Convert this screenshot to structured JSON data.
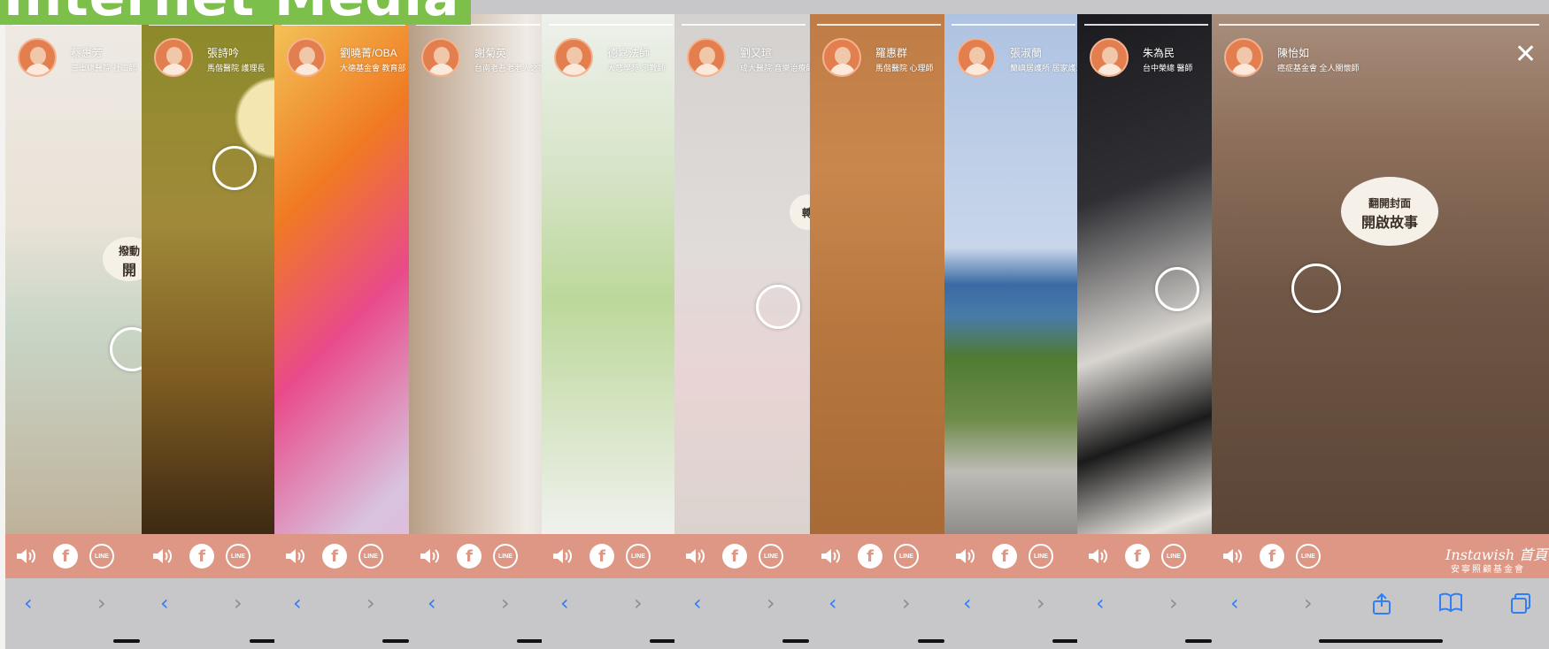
{
  "banner": {
    "text": "Internet Media"
  },
  "stories": [
    {
      "name": "蔡惠芳",
      "role": "三軍總醫院 社工師"
    },
    {
      "name": "張詩吟",
      "role": "馬偕醫院 護理長"
    },
    {
      "name": "劉曉菁/OBA",
      "role": "大德基金會 教育部"
    },
    {
      "name": "謝菊英",
      "role": "台南老吾老老人之家"
    },
    {
      "name": "德嘉法師",
      "role": "大悲學苑 宗教師"
    },
    {
      "name": "劉又瑄",
      "role": "成大醫院 音樂治療師"
    },
    {
      "name": "羅惠群",
      "role": "馬偕醫院 心理師"
    },
    {
      "name": "張淑蘭",
      "role": "蘭嶼居護所 居家護理師"
    },
    {
      "name": "朱為民",
      "role": "台中榮總 醫師"
    },
    {
      "name": "陳怡如",
      "role": "癌症基金會 全人關懷師"
    }
  ],
  "bubbles": {
    "s1": "撥動",
    "s1b": "開",
    "s6": "轉",
    "s10a": "翻開封面",
    "s10b": "開啟故事"
  },
  "actions": {
    "sound": "sound-icon",
    "facebook": "f",
    "line": "LINE"
  },
  "nav": {
    "back": "‹",
    "forward": "›",
    "share": "share-icon",
    "bookmarks": "book-icon",
    "tabs": "tabs-icon"
  },
  "brand": {
    "line1": "Instawish 首頁",
    "line2": "安寧照顧基金會"
  },
  "colors": {
    "accent": "#dd9784",
    "nav_blue": "#2f7ef6"
  }
}
